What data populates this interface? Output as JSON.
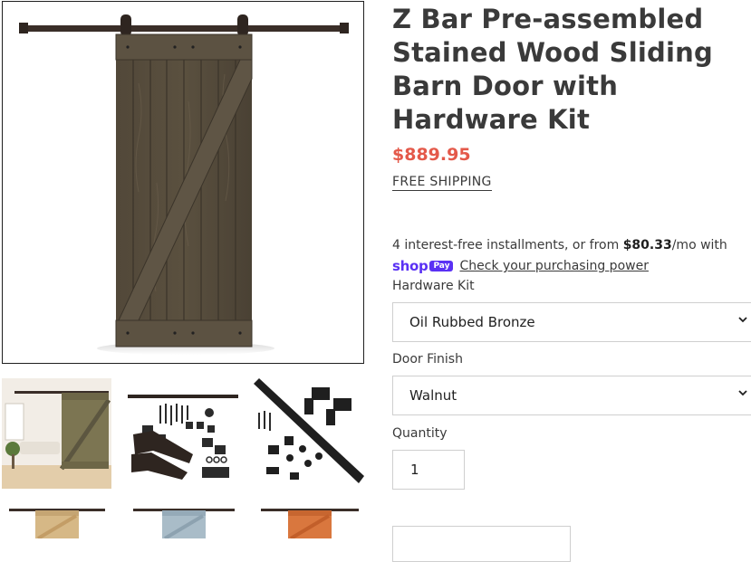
{
  "product": {
    "title": "Z Bar Pre-assembled Stained Wood Sliding Barn Door with Hardware Kit",
    "price": "$889.95",
    "shipping": "FREE SHIPPING"
  },
  "installments": {
    "text_before": "4 interest-free installments, or from ",
    "amount": "$80.33",
    "text_after": "/mo with"
  },
  "shoppay": {
    "shop_word": "shop",
    "pay_badge": "Pay",
    "link": "Check your purchasing power"
  },
  "options": {
    "hardware_label": "Hardware Kit",
    "hardware_value": "Oil Rubbed Bronze",
    "finish_label": "Door Finish",
    "finish_value": "Walnut",
    "quantity_label": "Quantity",
    "quantity_value": "1"
  },
  "thumbnails": [
    {
      "name": "room-scene"
    },
    {
      "name": "hardware-kit-parts"
    },
    {
      "name": "hardware-kit-rail"
    },
    {
      "name": "natural-finish"
    },
    {
      "name": "grey-finish"
    },
    {
      "name": "orange-finish"
    }
  ],
  "colors": {
    "accent_price": "#e4594a",
    "shop_pay": "#5a31f4",
    "door_stain": "#4e4538",
    "rail": "#3a2e28"
  },
  "icons": {
    "select_arrow": "chevron-down-icon"
  }
}
